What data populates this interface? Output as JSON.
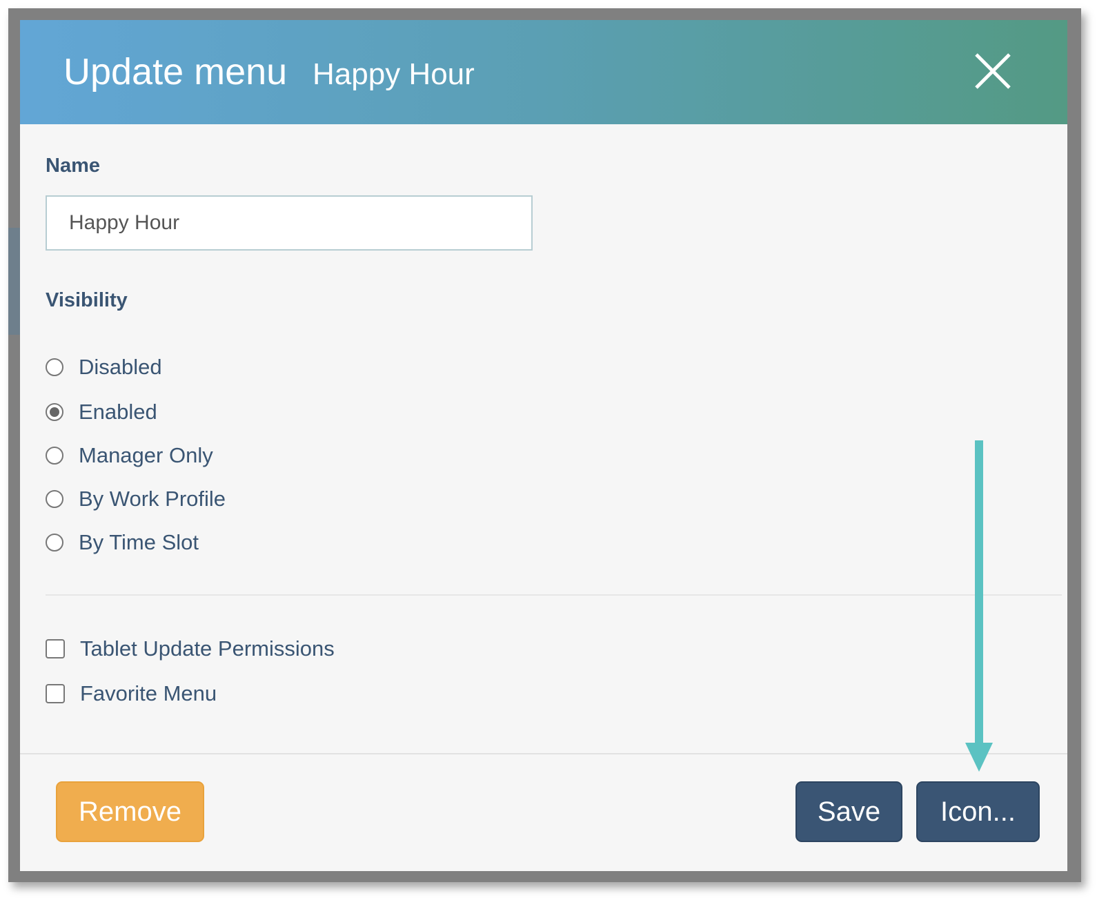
{
  "dialog": {
    "title": "Update menu",
    "subtitle": "Happy Hour",
    "close_icon": "close-icon"
  },
  "name": {
    "label": "Name",
    "value": "Happy Hour"
  },
  "visibility": {
    "label": "Visibility",
    "selected": "Enabled",
    "options": [
      {
        "label": "Disabled",
        "checked": false
      },
      {
        "label": "Enabled",
        "checked": true
      },
      {
        "label": "Manager Only",
        "checked": false
      },
      {
        "label": "By Work Profile",
        "checked": false
      },
      {
        "label": "By Time Slot",
        "checked": false
      }
    ]
  },
  "checkboxes": [
    {
      "label": "Tablet Update Permissions",
      "checked": false
    },
    {
      "label": "Favorite Menu",
      "checked": false
    }
  ],
  "footer": {
    "remove_label": "Remove",
    "save_label": "Save",
    "icon_label": "Icon..."
  },
  "colors": {
    "header_start": "#62a6d6",
    "header_end": "#549a84",
    "primary_button": "#3a5574",
    "remove_button": "#f0ad4e",
    "annotation_arrow": "#5bc2c2"
  }
}
